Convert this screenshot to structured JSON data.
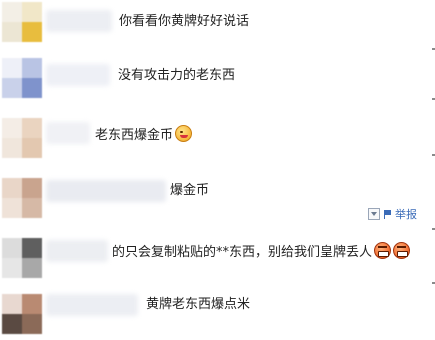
{
  "comments": [
    {
      "text": "你看看你黄牌好好说话",
      "emoji": null
    },
    {
      "text": "没有攻击力的老东西",
      "emoji": null
    },
    {
      "text": "老东西爆金币",
      "emoji": "wink-tongue-emoji"
    },
    {
      "text": "爆金币",
      "emoji": null
    },
    {
      "text": "的只会复制粘贴的**东西，别给我们皇牌丢人",
      "emoji": "angry-grimace-emoji"
    },
    {
      "text": "黄牌老东西爆点米",
      "emoji": null
    }
  ],
  "report": {
    "label": "举报"
  },
  "colors": {
    "text": "#222222",
    "link": "#3a6bb8",
    "background": "#ffffff"
  }
}
